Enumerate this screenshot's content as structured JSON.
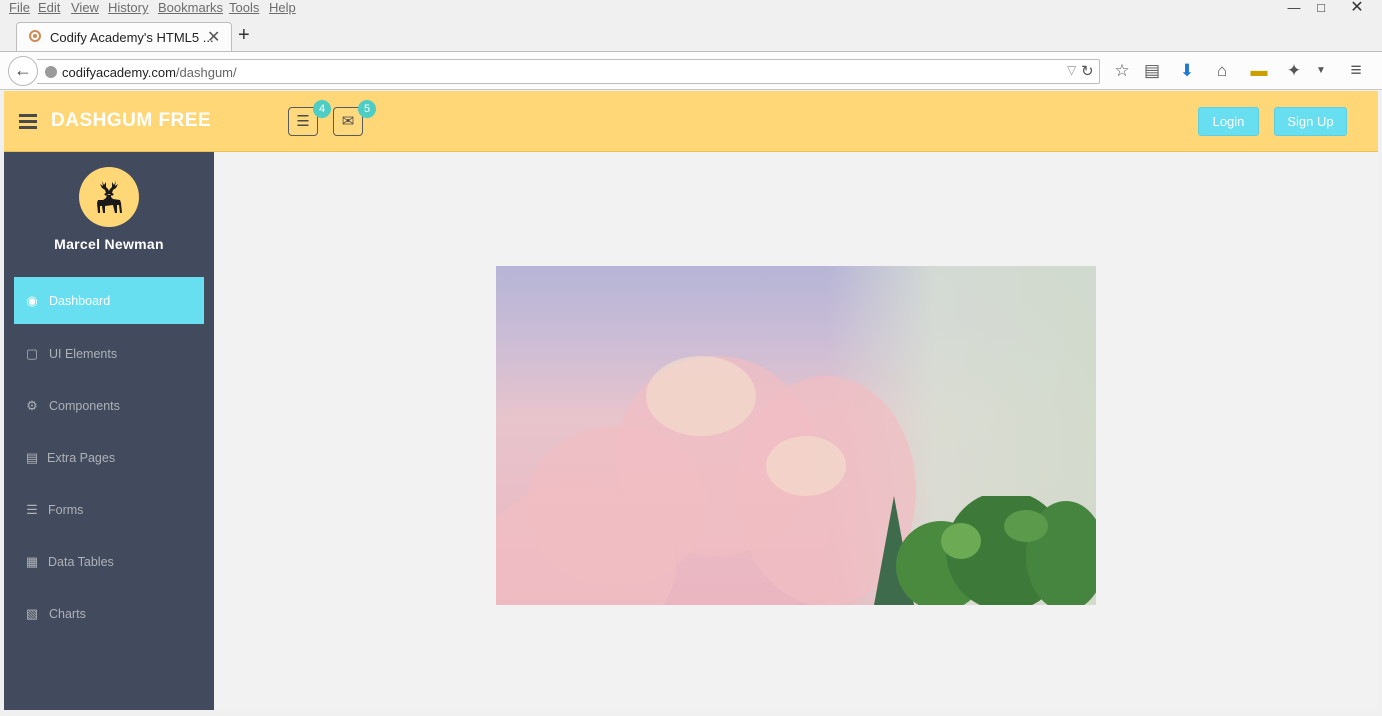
{
  "browser": {
    "menu": [
      "File",
      "Edit",
      "View",
      "History",
      "Bookmarks",
      "Tools",
      "Help"
    ],
    "tab_title": "Codify Academy's HTML5 ...",
    "url_domain": "codifyacademy.com",
    "url_path": "/dashgum/"
  },
  "header": {
    "logo": "DASHGUM FREE",
    "tasks_badge": "4",
    "messages_badge": "5",
    "login_label": "Login",
    "signup_label": "Sign Up"
  },
  "sidebar": {
    "username": "Marcel Newman",
    "items": [
      {
        "label": "Dashboard",
        "icon": "dashboard-icon"
      },
      {
        "label": "UI Elements",
        "icon": "desktop-icon"
      },
      {
        "label": "Components",
        "icon": "cogs-icon"
      },
      {
        "label": "Extra Pages",
        "icon": "book-icon"
      },
      {
        "label": "Forms",
        "icon": "tasks-icon"
      },
      {
        "label": "Data Tables",
        "icon": "th-icon"
      },
      {
        "label": "Charts",
        "icon": "bar-chart-icon"
      }
    ]
  },
  "colors": {
    "header": "#ffd777",
    "sidebar": "#424a5d",
    "accent": "#68dff0",
    "badge": "#4ecdc4"
  }
}
